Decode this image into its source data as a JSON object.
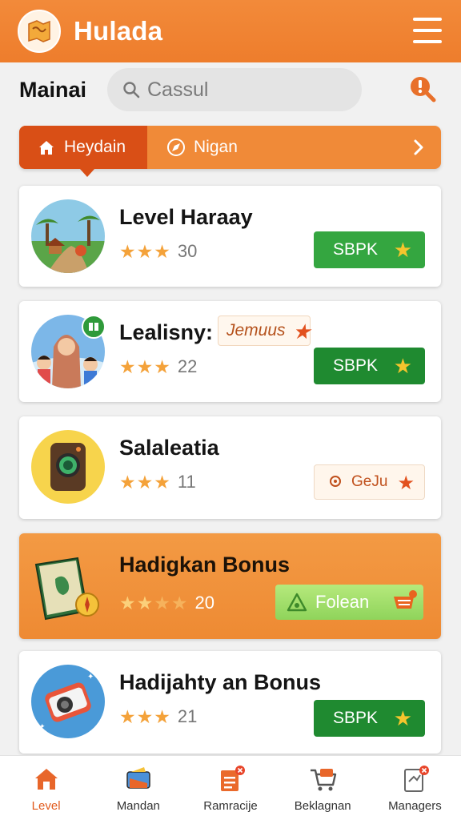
{
  "header": {
    "app_title": "Hulada"
  },
  "search": {
    "section_label": "Mainai",
    "placeholder": "Cassul"
  },
  "tabs": [
    {
      "label": "Heydain",
      "active": true
    },
    {
      "label": "Nigan",
      "active": false
    }
  ],
  "cards": [
    {
      "title": "Level Haraay",
      "stars": 3,
      "rating": "30",
      "action": "SBPK"
    },
    {
      "title": "Lealisny:",
      "tag": "Jemuus",
      "stars": 3,
      "rating": "22",
      "action": "SBPK"
    },
    {
      "title": "Salaleatia",
      "stars": 3,
      "rating": "11",
      "action": "GeJu"
    },
    {
      "title": "Hadigkan Bonus",
      "stars": 2,
      "rating": "20",
      "action": "Folean"
    },
    {
      "title": "Hadijahty an Bonus",
      "stars": 3,
      "rating": "21",
      "action": "SBPK"
    }
  ],
  "bottom_nav": [
    {
      "label": "Level",
      "active": true
    },
    {
      "label": "Mandan",
      "active": false
    },
    {
      "label": "Ramracije",
      "active": false
    },
    {
      "label": "Beklagnan",
      "active": false
    },
    {
      "label": "Managers",
      "active": false
    }
  ],
  "colors": {
    "primary": "#ee7d2c",
    "tab_active": "#d94f16",
    "action_green": "#34a640",
    "star": "#f4a23a"
  }
}
